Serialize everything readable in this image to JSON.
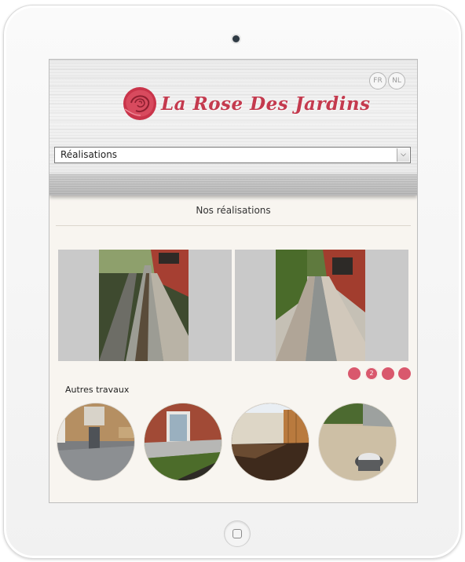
{
  "site": {
    "logo_text": "La Rose Des Jardins"
  },
  "languages": [
    {
      "label": "FR"
    },
    {
      "label": "NL"
    }
  ],
  "nav": {
    "selected": "Réalisations"
  },
  "main": {
    "title": "Nos réalisations",
    "carousel": {
      "current_page": 2,
      "pages": [
        "",
        "2",
        "",
        ""
      ]
    },
    "other_title": "Autres travaux"
  },
  "colors": {
    "accent": "#d9586d",
    "logo": "#c43a4e",
    "background": "#f8f5f0"
  }
}
